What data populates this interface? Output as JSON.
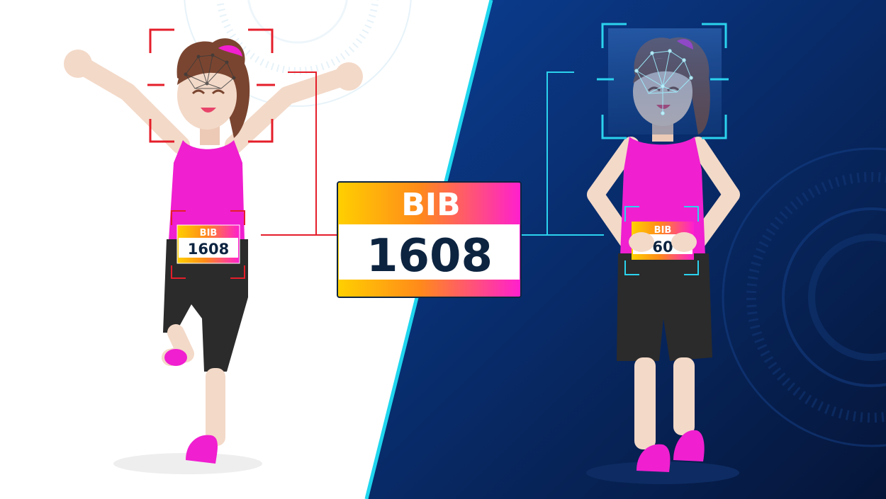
{
  "bib": {
    "label": "BIB",
    "number": "1608",
    "partial_number": "60"
  },
  "colors": {
    "background_left": "#ffffff",
    "background_right_top": "#0a3a8c",
    "background_right_bottom": "#061a44",
    "divider": "#1fd6ee",
    "scan_red": "#e41e2a",
    "scan_cyan": "#2bd3ee",
    "shirt": "#f01fd0",
    "shorts": "#2b2b2b",
    "skin": "#f3d9c8",
    "hair": "#7a4530",
    "bib_gradient_start": "#ffcc00",
    "bib_gradient_end": "#ff1fcf",
    "bib_number_text": "#0d2440"
  },
  "icons": {
    "left_face_scan": "face-mesh-icon",
    "right_face_scan": "face-mesh-icon"
  }
}
